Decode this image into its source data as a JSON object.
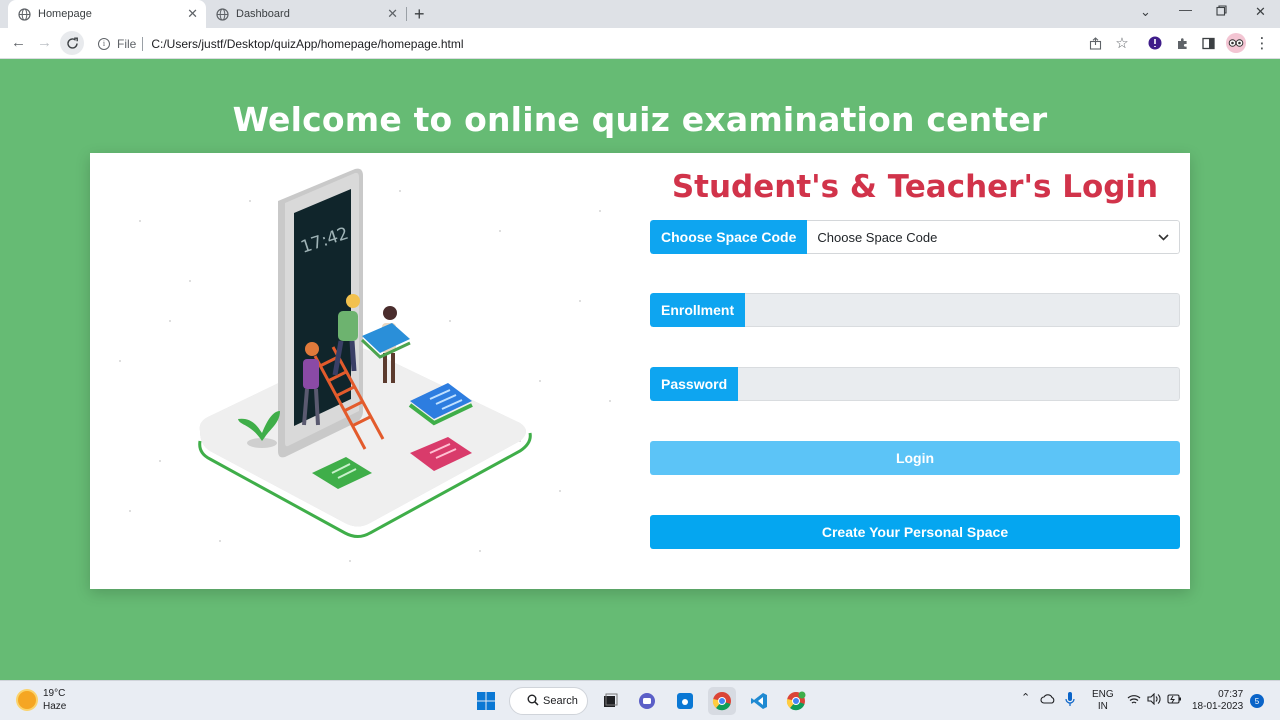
{
  "browser": {
    "tabs": [
      {
        "title": "Homepage",
        "active": true
      },
      {
        "title": "Dashboard",
        "active": false
      }
    ],
    "address_scheme": "File",
    "address_url": "C:/Users/justf/Desktop/quizApp/homepage/homepage.html"
  },
  "page": {
    "title": "Welcome to online quiz examination center",
    "login_title": "Student's & Teacher's Login",
    "space_code": {
      "label": "Choose Space Code",
      "selected": "Choose Space Code"
    },
    "enrollment": {
      "label": "Enrollment",
      "value": ""
    },
    "password": {
      "label": "Password",
      "value": ""
    },
    "login_button": "Login",
    "create_button": "Create Your Personal Space",
    "illustration_clock": "17:42"
  },
  "taskbar": {
    "weather_temp": "19°C",
    "weather_desc": "Haze",
    "search_label": "Search",
    "lang_1": "ENG",
    "lang_2": "IN",
    "time": "07:37",
    "date": "18-01-2023",
    "notification_count": "5"
  },
  "colors": {
    "background": "#66bb74",
    "accent": "#05a6f0",
    "login_title": "#d1334a",
    "login_button": "#5cc4f7"
  }
}
